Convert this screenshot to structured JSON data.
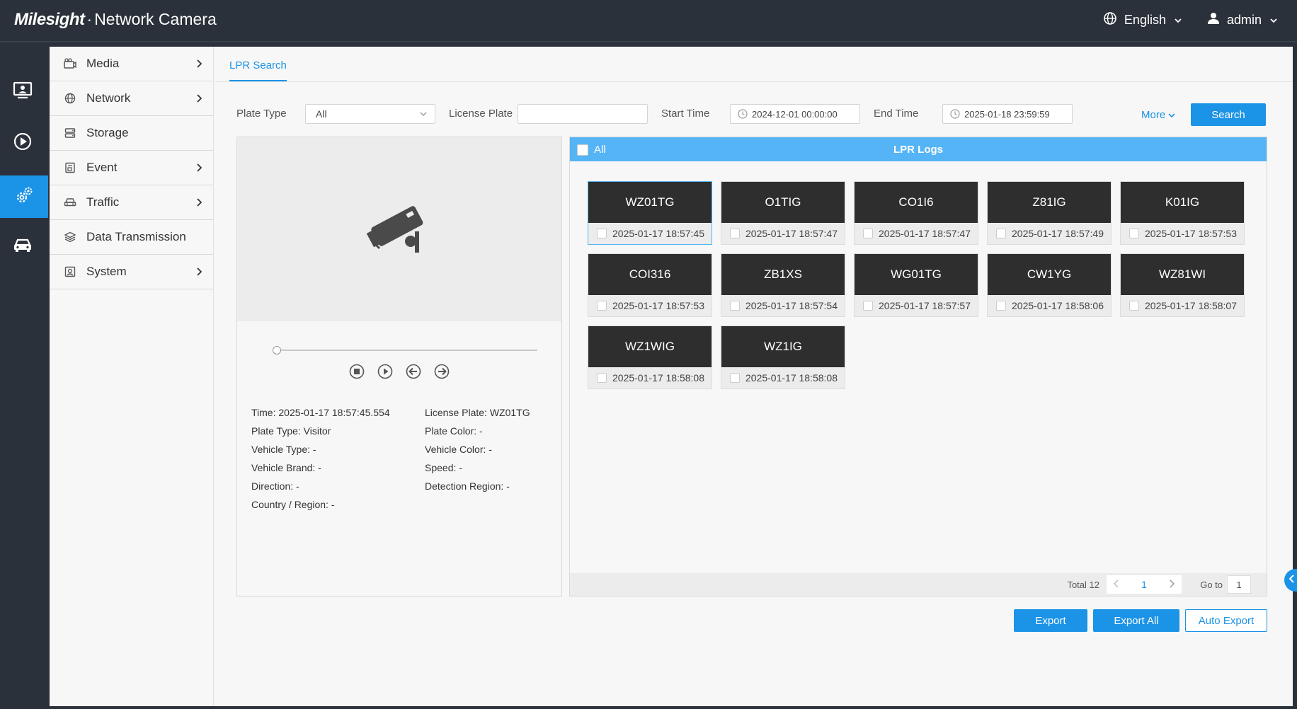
{
  "header": {
    "brand": "Milesight",
    "product": "Network Camera",
    "language": "English",
    "user": "admin"
  },
  "menu": {
    "items": [
      {
        "label": "Media",
        "icon": "camera-icon",
        "has_children": true
      },
      {
        "label": "Network",
        "icon": "globe-icon",
        "has_children": true
      },
      {
        "label": "Storage",
        "icon": "storage-icon",
        "has_children": false
      },
      {
        "label": "Event",
        "icon": "event-icon",
        "has_children": true
      },
      {
        "label": "Traffic",
        "icon": "car-icon",
        "has_children": true
      },
      {
        "label": "Data Transmission",
        "icon": "layers-icon",
        "has_children": false
      },
      {
        "label": "System",
        "icon": "system-icon",
        "has_children": true
      }
    ]
  },
  "tab": {
    "label": "LPR Search"
  },
  "filters": {
    "plate_type_label": "Plate Type",
    "plate_type_value": "All",
    "license_plate_label": "License Plate",
    "license_plate_value": "",
    "start_time_label": "Start Time",
    "start_time_value": "2024-12-01 00:00:00",
    "end_time_label": "End Time",
    "end_time_value": "2025-01-18 23:59:59",
    "more_label": "More",
    "search_label": "Search"
  },
  "details": {
    "time": "Time: 2025-01-17 18:57:45.554",
    "plate_type": "Plate Type: Visitor",
    "vehicle_type": "Vehicle Type: -",
    "vehicle_brand": "Vehicle Brand: -",
    "direction": "Direction: -",
    "country": "Country / Region: -",
    "license_plate": "License Plate: WZ01TG",
    "plate_color": "Plate Color: -",
    "vehicle_color": "Vehicle Color: -",
    "speed": "Speed: -",
    "detection_region": "Detection Region: -"
  },
  "logs": {
    "all_label": "All",
    "title": "LPR Logs",
    "items": [
      {
        "plate": "WZ01TG",
        "time": "2025-01-17 18:57:45"
      },
      {
        "plate": "O1TIG",
        "time": "2025-01-17 18:57:47"
      },
      {
        "plate": "CO1I6",
        "time": "2025-01-17 18:57:47"
      },
      {
        "plate": "Z81IG",
        "time": "2025-01-17 18:57:49"
      },
      {
        "plate": "K01IG",
        "time": "2025-01-17 18:57:53"
      },
      {
        "plate": "COI316",
        "time": "2025-01-17 18:57:53"
      },
      {
        "plate": "ZB1XS",
        "time": "2025-01-17 18:57:54"
      },
      {
        "plate": "WG01TG",
        "time": "2025-01-17 18:57:57"
      },
      {
        "plate": "CW1YG",
        "time": "2025-01-17 18:58:06"
      },
      {
        "plate": "WZ81WI",
        "time": "2025-01-17 18:58:07"
      },
      {
        "plate": "WZ1WIG",
        "time": "2025-01-17 18:58:08"
      },
      {
        "plate": "WZ1IG",
        "time": "2025-01-17 18:58:08"
      }
    ]
  },
  "pager": {
    "total": "Total 12",
    "page": "1",
    "goto_label": "Go to",
    "goto_value": "1"
  },
  "actions": {
    "export": "Export",
    "export_all": "Export All",
    "auto_export": "Auto Export"
  },
  "colors": {
    "accent": "#1b93e6",
    "header_bg": "#2b313a",
    "logs_header": "#55b4f5"
  }
}
